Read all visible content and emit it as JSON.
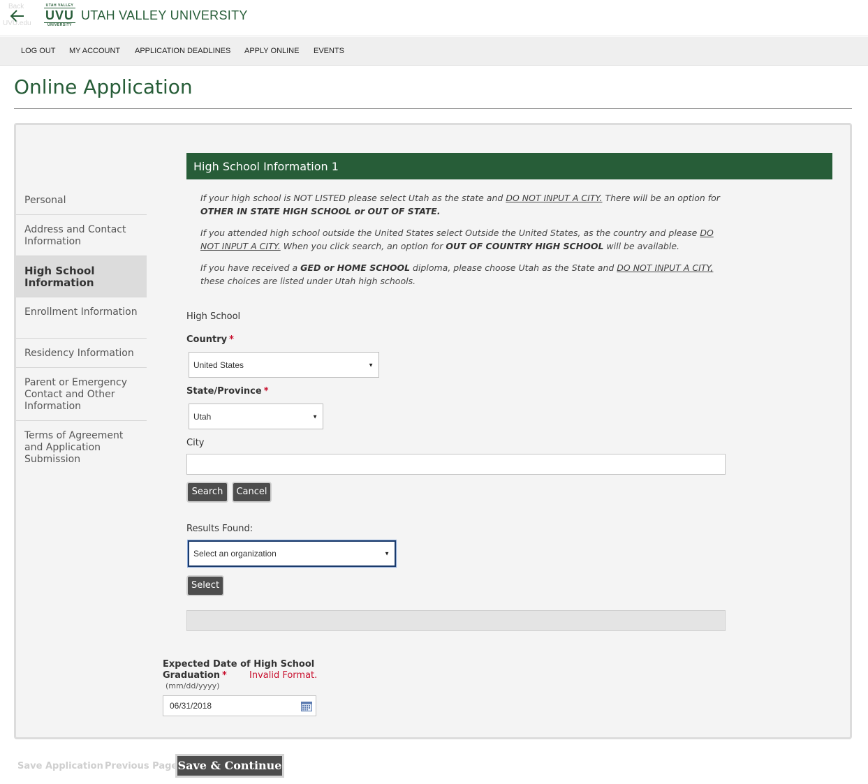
{
  "header": {
    "back_label": "Back",
    "back_site": "UVU.edu",
    "logo_top": "UTAH VALLEY",
    "logo_mid": "UVU",
    "logo_bot": "UNIVERSITY",
    "university_name": "UTAH VALLEY UNIVERSITY"
  },
  "nav": {
    "items": [
      "LOG OUT",
      "MY ACCOUNT",
      "APPLICATION DEADLINES",
      "APPLY ONLINE",
      "EVENTS"
    ]
  },
  "page": {
    "title": "Online Application"
  },
  "sidebar": {
    "items": [
      {
        "label": "Personal"
      },
      {
        "label": "Address and Contact Information"
      },
      {
        "label": "High School Information"
      },
      {
        "label": "Enrollment Information"
      },
      {
        "label": "Residency Information"
      },
      {
        "label": "Parent or Emergency Contact and Other Information"
      },
      {
        "label": "Terms of Agreement and Application Submission"
      }
    ]
  },
  "section": {
    "header": "High School Information 1",
    "note1": {
      "t1": "If your high school is NOT LISTED please select Utah as the state and ",
      "u1": "DO NOT INPUT A CITY.",
      "t2": " There will be an option for ",
      "b1": "OTHER IN STATE HIGH SCHOOL or OUT OF STATE."
    },
    "note2": {
      "t1": "If you attended high school outside the United States select Outside the United States, as the country and please ",
      "u1": "DO NOT INPUT A CITY.",
      "t2": " When you click search, an option for ",
      "b1": "OUT OF COUNTRY HIGH SCHOOL",
      "t3": " will be available."
    },
    "note3": {
      "t1": "If you have received a ",
      "b1": "GED or HOME SCHOOL",
      "t2": " diploma, please choose Utah as the State and ",
      "u1": "DO NOT INPUT A CITY,",
      "t3": " these choices are listed under Utah high schools."
    }
  },
  "form": {
    "high_school_label": "High School",
    "country_label": "Country",
    "country_value": "United States",
    "state_label": "State/Province",
    "state_value": "Utah",
    "city_label": "City",
    "city_value": "",
    "search_button": "Search",
    "cancel_button": "Cancel",
    "results_label": "Results Found:",
    "results_value": "Select an organization",
    "select_button": "Select",
    "required_mark": "*",
    "grad_label_line1": "Expected Date of High School",
    "grad_label_line2": "Graduation",
    "grad_error": "Invalid Format.",
    "grad_hint": "(mm/dd/yyyy)",
    "grad_value": "06/31/2018"
  },
  "footer": {
    "save_application": "Save Application",
    "previous_page": "Previous Page",
    "save_continue": "Save & Continue"
  },
  "colors": {
    "brand_green": "#275d38",
    "required_red": "#c8102e",
    "button_dark": "#4d4d4d"
  }
}
